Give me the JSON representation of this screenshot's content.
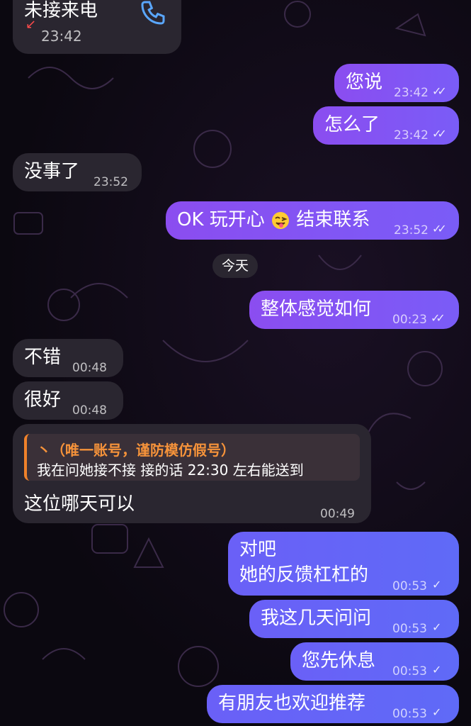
{
  "missed_call": {
    "label": "未接来电",
    "time": "23:42"
  },
  "date_separator": "今天",
  "messages": [
    {
      "dir": "out",
      "text": "您说",
      "time": "23:42",
      "read": true
    },
    {
      "dir": "out",
      "text": "怎么了",
      "time": "23:42",
      "read": true
    },
    {
      "dir": "in",
      "text": "没事了",
      "time": "23:52"
    },
    {
      "dir": "out",
      "text_a": "OK 玩开心",
      "text_b": "结束联系",
      "time": "23:52",
      "read": true
    },
    {
      "dir": "out",
      "text": "整体感觉如何",
      "time": "00:23",
      "read": true
    },
    {
      "dir": "in",
      "text": "不错",
      "time": "00:48"
    },
    {
      "dir": "in",
      "text": "很好",
      "time": "00:48"
    },
    {
      "dir": "in",
      "reply_name": "丶（唯一账号，谨防模仿假号）",
      "reply_text": "我在问她接不接 接的话 22:30 左右能送到",
      "text": "这位哪天可以",
      "time": "00:49"
    },
    {
      "dir": "out",
      "line1": "对吧",
      "line2": "她的反馈杠杠的",
      "time": "00:53",
      "read": false
    },
    {
      "dir": "out",
      "text": "我这几天问问",
      "time": "00:53",
      "read": false
    },
    {
      "dir": "out",
      "text": "您先休息",
      "time": "00:53",
      "read": false
    },
    {
      "dir": "out",
      "text": "有朋友也欢迎推荐",
      "time": "00:53",
      "read": false
    }
  ],
  "icons": {
    "double_check": "✓✓",
    "single_check": "✓",
    "missed_arrow": "↙"
  },
  "colors": {
    "incoming": "#2a2630",
    "outgoing": "#8b4df0",
    "outgoing_late": "#6a60f7",
    "reply_accent": "#f0822a"
  }
}
